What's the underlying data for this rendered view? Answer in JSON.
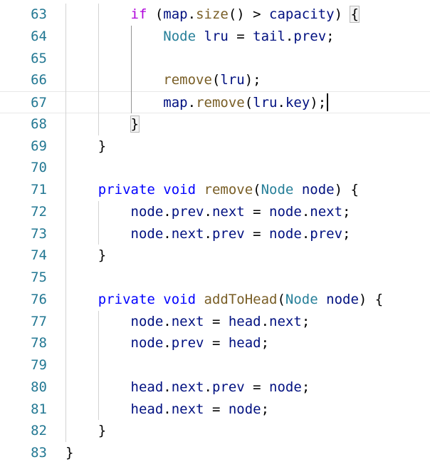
{
  "editor": {
    "cursor_line": "67",
    "lines": [
      {
        "n": "63",
        "indent": "        ",
        "tokens": [
          [
            "kw2",
            "if"
          ],
          [
            "pn",
            " ("
          ],
          [
            "vr",
            "map"
          ],
          [
            "pn",
            "."
          ],
          [
            "fn",
            "size"
          ],
          [
            "pn",
            "() > "
          ],
          [
            "vr",
            "capacity"
          ],
          [
            "pn",
            ") "
          ],
          [
            "bm",
            "{"
          ]
        ]
      },
      {
        "n": "64",
        "indent": "            ",
        "tokens": [
          [
            "ty",
            "Node"
          ],
          [
            "pn",
            " "
          ],
          [
            "vr",
            "lru"
          ],
          [
            "pn",
            " = "
          ],
          [
            "vr",
            "tail"
          ],
          [
            "pn",
            "."
          ],
          [
            "vr",
            "prev"
          ],
          [
            "pn",
            ";"
          ]
        ]
      },
      {
        "n": "65",
        "indent": "",
        "tokens": []
      },
      {
        "n": "66",
        "indent": "            ",
        "tokens": [
          [
            "fn",
            "remove"
          ],
          [
            "pn",
            "("
          ],
          [
            "vr",
            "lru"
          ],
          [
            "pn",
            ");"
          ]
        ]
      },
      {
        "n": "67",
        "indent": "            ",
        "tokens": [
          [
            "vr",
            "map"
          ],
          [
            "pn",
            "."
          ],
          [
            "fn",
            "remove"
          ],
          [
            "pn",
            "("
          ],
          [
            "vr",
            "lru"
          ],
          [
            "pn",
            "."
          ],
          [
            "vr",
            "key"
          ],
          [
            "pn",
            ");"
          ]
        ]
      },
      {
        "n": "68",
        "indent": "        ",
        "tokens": [
          [
            "bm",
            "}"
          ]
        ]
      },
      {
        "n": "69",
        "indent": "    ",
        "tokens": [
          [
            "pn",
            "}"
          ]
        ]
      },
      {
        "n": "70",
        "indent": "",
        "tokens": []
      },
      {
        "n": "71",
        "indent": "    ",
        "tokens": [
          [
            "kw",
            "private"
          ],
          [
            "pn",
            " "
          ],
          [
            "kw",
            "void"
          ],
          [
            "pn",
            " "
          ],
          [
            "fn",
            "remove"
          ],
          [
            "pn",
            "("
          ],
          [
            "ty",
            "Node"
          ],
          [
            "pn",
            " "
          ],
          [
            "vr",
            "node"
          ],
          [
            "pn",
            ") {"
          ]
        ]
      },
      {
        "n": "72",
        "indent": "        ",
        "tokens": [
          [
            "vr",
            "node"
          ],
          [
            "pn",
            "."
          ],
          [
            "vr",
            "prev"
          ],
          [
            "pn",
            "."
          ],
          [
            "vr",
            "next"
          ],
          [
            "pn",
            " = "
          ],
          [
            "vr",
            "node"
          ],
          [
            "pn",
            "."
          ],
          [
            "vr",
            "next"
          ],
          [
            "pn",
            ";"
          ]
        ]
      },
      {
        "n": "73",
        "indent": "        ",
        "tokens": [
          [
            "vr",
            "node"
          ],
          [
            "pn",
            "."
          ],
          [
            "vr",
            "next"
          ],
          [
            "pn",
            "."
          ],
          [
            "vr",
            "prev"
          ],
          [
            "pn",
            " = "
          ],
          [
            "vr",
            "node"
          ],
          [
            "pn",
            "."
          ],
          [
            "vr",
            "prev"
          ],
          [
            "pn",
            ";"
          ]
        ]
      },
      {
        "n": "74",
        "indent": "    ",
        "tokens": [
          [
            "pn",
            "}"
          ]
        ]
      },
      {
        "n": "75",
        "indent": "",
        "tokens": []
      },
      {
        "n": "76",
        "indent": "    ",
        "tokens": [
          [
            "kw",
            "private"
          ],
          [
            "pn",
            " "
          ],
          [
            "kw",
            "void"
          ],
          [
            "pn",
            " "
          ],
          [
            "fn",
            "addToHead"
          ],
          [
            "pn",
            "("
          ],
          [
            "ty",
            "Node"
          ],
          [
            "pn",
            " "
          ],
          [
            "vr",
            "node"
          ],
          [
            "pn",
            ") {"
          ]
        ]
      },
      {
        "n": "77",
        "indent": "        ",
        "tokens": [
          [
            "vr",
            "node"
          ],
          [
            "pn",
            "."
          ],
          [
            "vr",
            "next"
          ],
          [
            "pn",
            " = "
          ],
          [
            "vr",
            "head"
          ],
          [
            "pn",
            "."
          ],
          [
            "vr",
            "next"
          ],
          [
            "pn",
            ";"
          ]
        ]
      },
      {
        "n": "78",
        "indent": "        ",
        "tokens": [
          [
            "vr",
            "node"
          ],
          [
            "pn",
            "."
          ],
          [
            "vr",
            "prev"
          ],
          [
            "pn",
            " = "
          ],
          [
            "vr",
            "head"
          ],
          [
            "pn",
            ";"
          ]
        ]
      },
      {
        "n": "79",
        "indent": "",
        "tokens": []
      },
      {
        "n": "80",
        "indent": "        ",
        "tokens": [
          [
            "vr",
            "head"
          ],
          [
            "pn",
            "."
          ],
          [
            "vr",
            "next"
          ],
          [
            "pn",
            "."
          ],
          [
            "vr",
            "prev"
          ],
          [
            "pn",
            " = "
          ],
          [
            "vr",
            "node"
          ],
          [
            "pn",
            ";"
          ]
        ]
      },
      {
        "n": "81",
        "indent": "        ",
        "tokens": [
          [
            "vr",
            "head"
          ],
          [
            "pn",
            "."
          ],
          [
            "vr",
            "next"
          ],
          [
            "pn",
            " = "
          ],
          [
            "vr",
            "node"
          ],
          [
            "pn",
            ";"
          ]
        ]
      },
      {
        "n": "82",
        "indent": "    ",
        "tokens": [
          [
            "pn",
            "}"
          ]
        ]
      },
      {
        "n": "83",
        "indent": "",
        "tokens": [
          [
            "pn",
            "}"
          ]
        ]
      }
    ]
  },
  "colors": {
    "line_number": "#237893",
    "keyword": "#0000ff",
    "control_keyword": "#af00db",
    "type": "#267f99",
    "function": "#795e26",
    "variable": "#001080"
  }
}
